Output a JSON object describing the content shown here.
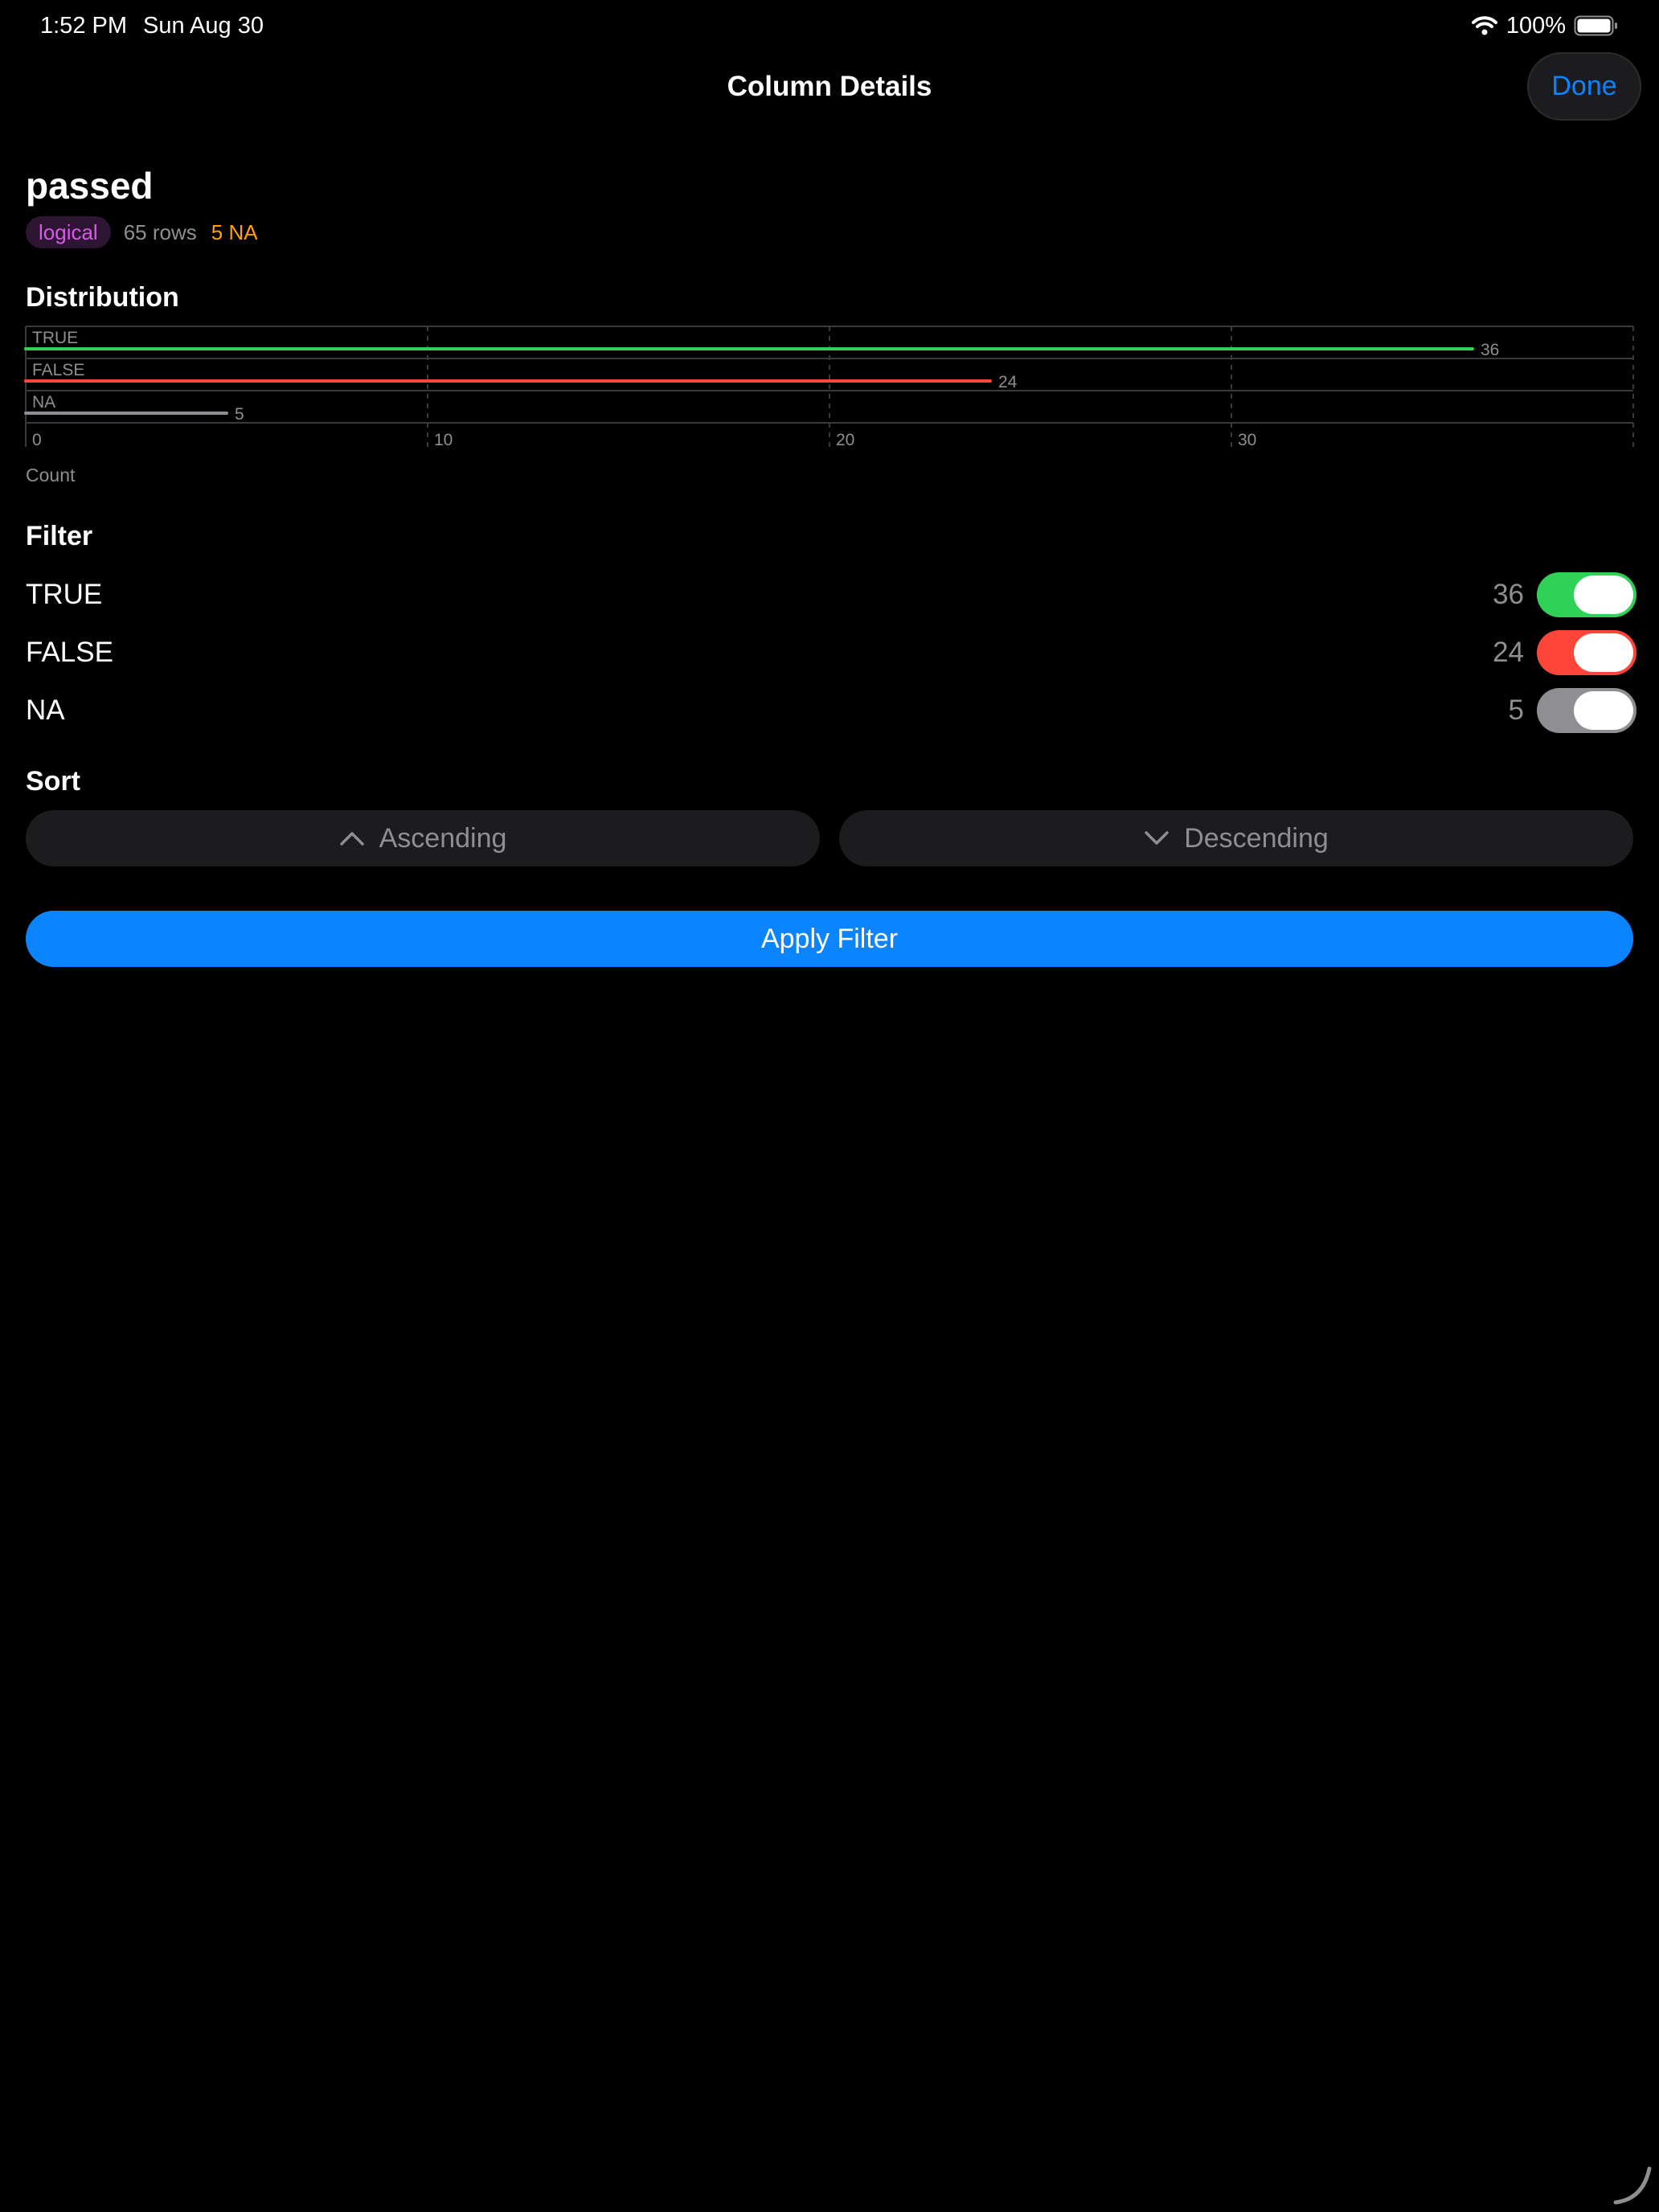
{
  "status_bar": {
    "time": "1:52 PM",
    "date": "Sun Aug 30",
    "battery": "100%",
    "icons": [
      "wifi-icon",
      "battery-icon"
    ]
  },
  "nav": {
    "title": "Column Details",
    "done_label": "Done"
  },
  "column": {
    "name": "passed",
    "type": "logical",
    "rows": "65 rows",
    "na": "5 NA"
  },
  "distribution": {
    "title": "Distribution",
    "axis_label": "Count"
  },
  "chart_data": {
    "type": "bar",
    "orientation": "horizontal",
    "categories": [
      "TRUE",
      "FALSE",
      "NA"
    ],
    "values": [
      36,
      24,
      5
    ],
    "value_labels": [
      "36",
      "24",
      "5"
    ],
    "colors": [
      "#30d158",
      "#ff453a",
      "#8e8e93"
    ],
    "xlabel": "Count",
    "xlim": [
      0,
      40
    ],
    "xticks": [
      0,
      10,
      20,
      30
    ],
    "grid": true
  },
  "filter": {
    "title": "Filter",
    "items": [
      {
        "label": "TRUE",
        "count": "36",
        "enabled": true,
        "color": "#30d158"
      },
      {
        "label": "FALSE",
        "count": "24",
        "enabled": true,
        "color": "#ff453a"
      },
      {
        "label": "NA",
        "count": "5",
        "enabled": true,
        "color": "#8e8e93"
      }
    ]
  },
  "sort": {
    "title": "Sort",
    "ascending_label": "Ascending",
    "descending_label": "Descending"
  },
  "apply_label": "Apply Filter",
  "colors": {
    "accent": "#0a84ff",
    "background": "#000000",
    "badge_text": "#d65ce6",
    "na_text": "#ff9f0a"
  }
}
